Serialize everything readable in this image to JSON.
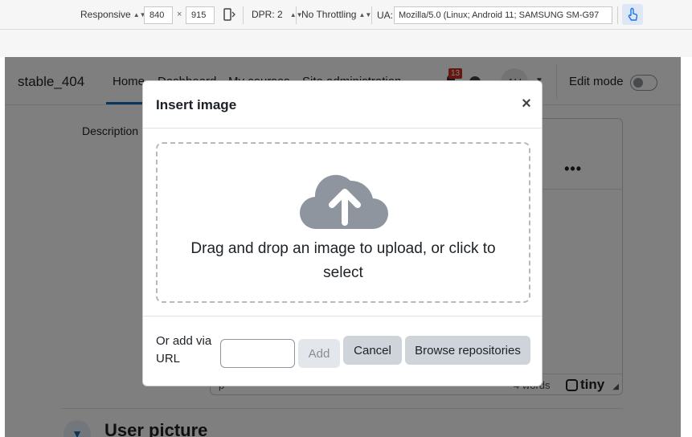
{
  "devtools": {
    "device_mode": "Responsive",
    "width": "840",
    "times": "×",
    "height": "915",
    "dpr": "DPR: 2",
    "throttling": "No Throttling",
    "ua_label": "UA:",
    "ua_value": "Mozilla/5.0 (Linux; Android 11; SAMSUNG SM-G97",
    "icons": [
      "rotate-icon",
      "touch-icon"
    ]
  },
  "navbar": {
    "brand": "stable_404",
    "links": [
      "Home",
      "Dashboard",
      "My courses",
      "Site administration"
    ],
    "notification_count": "13",
    "avatar_initials": "AU",
    "edit_mode_label": "Edit mode",
    "edit_mode_on": false
  },
  "page": {
    "description_label": "Description",
    "editor_more": "•••",
    "status_path": "p",
    "word_count": "4 words",
    "tiny_brand": "tiny",
    "section_title": "User picture"
  },
  "modal": {
    "title": "Insert image",
    "close": "×",
    "dropzone_text": "Drag and drop an image to upload, or click to select",
    "url_label": "Or add via URL",
    "url_value": "",
    "add_label": "Add",
    "cancel_label": "Cancel",
    "browse_label": "Browse repositories"
  },
  "colors": {
    "accent": "#0f6cbf",
    "badge": "#ca3120",
    "button_secondary": "#ced4da",
    "cloud": "#8f959e"
  }
}
